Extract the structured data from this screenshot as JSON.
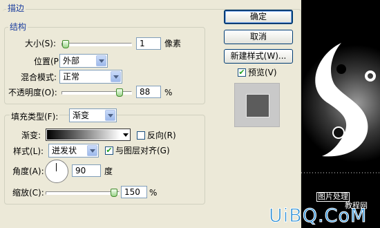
{
  "sections": {
    "stroke_title": "描边",
    "structure_title": "结构"
  },
  "structure": {
    "size_label": "大小(S):",
    "size_value": "1",
    "size_unit": "像素",
    "size_level": 0.01,
    "position_label": "位置(P):",
    "position_value": "外部",
    "blend_label": "混合模式:",
    "blend_value": "正常",
    "opacity_label": "不透明度(O):",
    "opacity_value": "88",
    "opacity_unit": "%",
    "opacity_level": 0.88
  },
  "fill": {
    "type_label": "填充类型(F):",
    "type_value": "渐变",
    "gradient_label": "渐变:",
    "reverse_label": "反向(R)",
    "reverse_checked": false,
    "style_label": "样式(L):",
    "style_value": "迸发状",
    "align_label": "与图层对齐(G)",
    "align_checked": true,
    "angle_label": "角度(A):",
    "angle_value": "90",
    "angle_unit": "度",
    "scale_label": "缩放(C):",
    "scale_value": "150",
    "scale_unit": "%",
    "scale_level": 0.99
  },
  "buttons": {
    "ok": "确定",
    "cancel": "取消",
    "new_style": "新建样式(W)..."
  },
  "preview": {
    "label": "预览(V)",
    "checked": true
  },
  "artwork": {
    "stamp_line1": "图片处理",
    "stamp_line2": "教程网",
    "watermark": "UiBQ.CoM"
  },
  "colors": {
    "dialog_bg": "#ECE9D8",
    "title_blue": "#1A3D9E",
    "button_border": "#003C74",
    "watermark_blue": "#2C8FD6"
  }
}
